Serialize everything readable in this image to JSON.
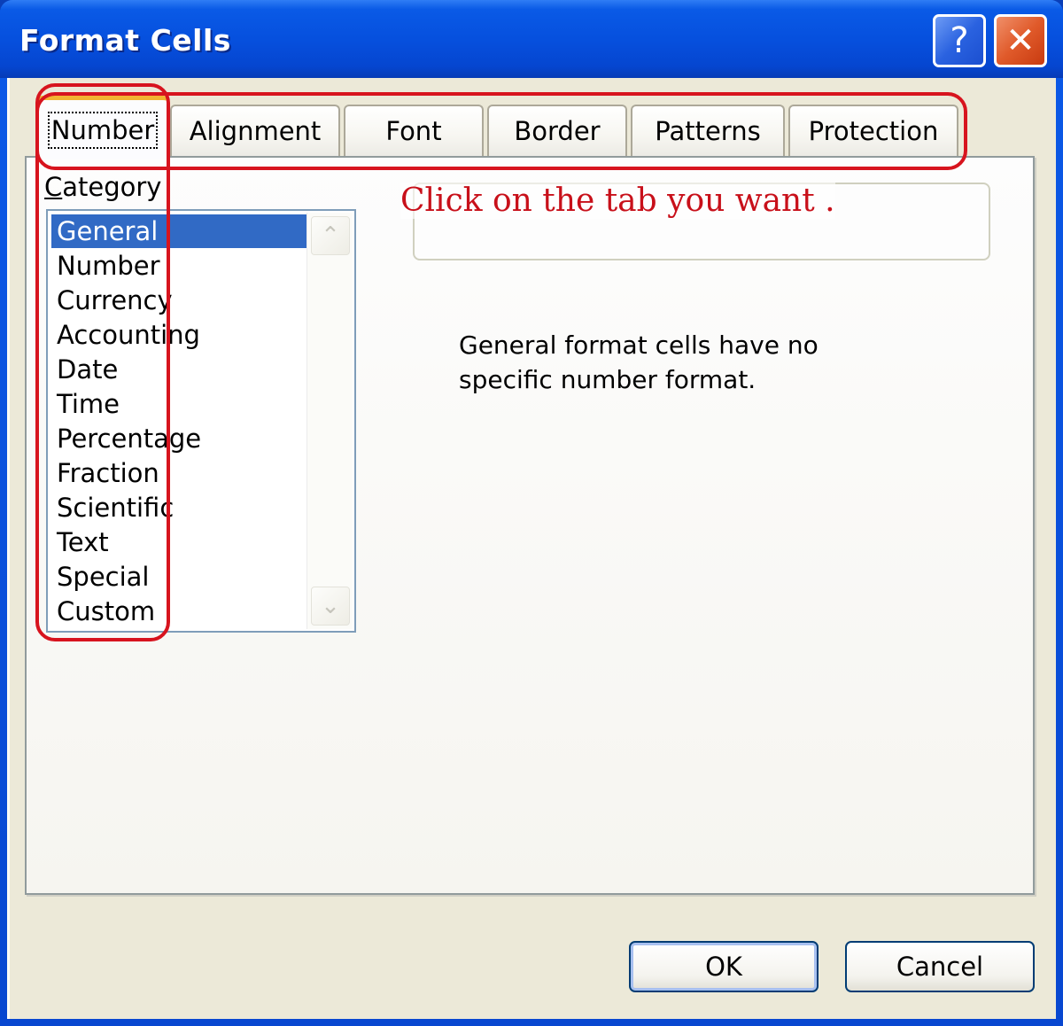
{
  "window": {
    "title": "Format Cells",
    "help_glyph": "?",
    "close_glyph": "✕"
  },
  "tabs": [
    {
      "label": "Number",
      "active": true
    },
    {
      "label": "Alignment",
      "active": false
    },
    {
      "label": "Font",
      "active": false
    },
    {
      "label": "Border",
      "active": false
    },
    {
      "label": "Patterns",
      "active": false
    },
    {
      "label": "Protection",
      "active": false
    }
  ],
  "category": {
    "label_mnemonic": "C",
    "label_rest": "ategory",
    "items": [
      "General",
      "Number",
      "Currency",
      "Accounting",
      "Date",
      "Time",
      "Percentage",
      "Fraction",
      "Scientific",
      "Text",
      "Special",
      "Custom"
    ],
    "selected": "General",
    "scroll_up_glyph": "⌃",
    "scroll_down_glyph": "⌄"
  },
  "annotation": {
    "text": "Click on the tab you want .",
    "color": "#c8101a"
  },
  "description": "General format cells have no specific number format.",
  "buttons": {
    "ok": "OK",
    "cancel": "Cancel"
  },
  "colors": {
    "titlebar": "#0650de",
    "selection": "#316ac5",
    "active_tab_accent": "#f2b431",
    "annotation_outline": "#d7141e"
  }
}
